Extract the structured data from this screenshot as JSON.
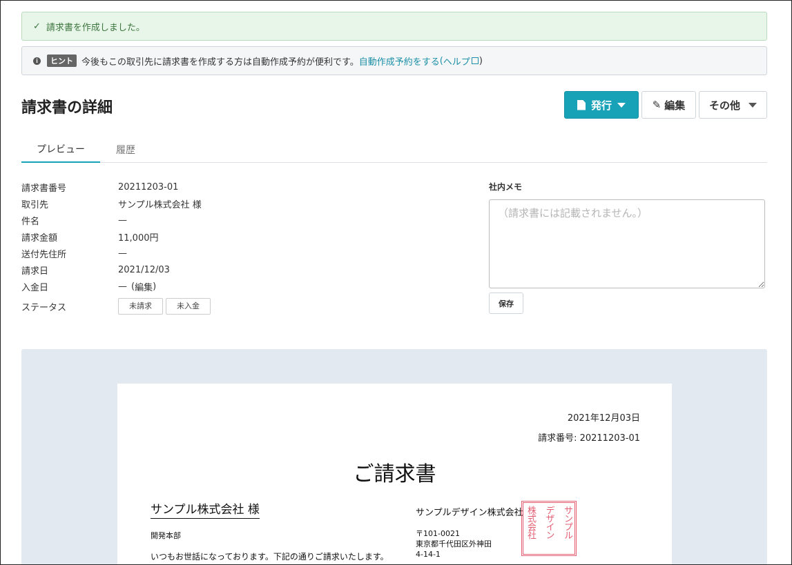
{
  "alerts": {
    "success": "請求書を作成しました。",
    "hint_badge": "ヒント",
    "hint_text": "今後もこの取引先に請求書を作成する方は自動作成予約が便利です。",
    "hint_link": "自動作成予約をする",
    "help_open": "(",
    "help_link": "ヘルプ",
    "help_close": ")"
  },
  "header": {
    "title": "請求書の詳細",
    "issue_label": "発行",
    "edit_label": "編集",
    "other_label": "その他"
  },
  "tabs": [
    {
      "label": "プレビュー"
    },
    {
      "label": "履歴"
    }
  ],
  "details": {
    "invoice_no_label": "請求書番号",
    "invoice_no": "20211203-01",
    "client_label": "取引先",
    "client": "サンプル株式会社 様",
    "subject_label": "件名",
    "subject": "—",
    "amount_label": "請求金額",
    "amount": "11,000円",
    "address_label": "送付先住所",
    "address": "—",
    "bill_date_label": "請求日",
    "bill_date": "2021/12/03",
    "paid_date_label": "入金日",
    "paid_date": "—",
    "paid_edit_open": "(",
    "paid_edit": "編集",
    "paid_edit_close": ")",
    "status_label": "ステータス",
    "status_tags": [
      "未請求",
      "未入金"
    ]
  },
  "memo": {
    "label": "社内メモ",
    "placeholder": "（請求書には記載されません。）",
    "save_label": "保存"
  },
  "invoice_preview": {
    "date": "2021年12月03日",
    "number": "請求番号: 20211203-01",
    "title": "ご請求書",
    "client": "サンプル株式会社 様",
    "department": "開発本部",
    "greeting": "いつもお世話になっております。下記の通りご請求いたします。",
    "company": "サンプルデザイン株式会社",
    "postal": "〒101-0021",
    "address1": "東京都千代田区外神田",
    "address2": "4-14-1",
    "stamp_col1": "サンプル",
    "stamp_col2": "デザイン",
    "stamp_col3": "株式会社"
  },
  "colors": {
    "accent": "#17a2b8",
    "link": "#1a8fa6",
    "success_bg": "#e8f5e9",
    "stamp": "#e0435a"
  }
}
